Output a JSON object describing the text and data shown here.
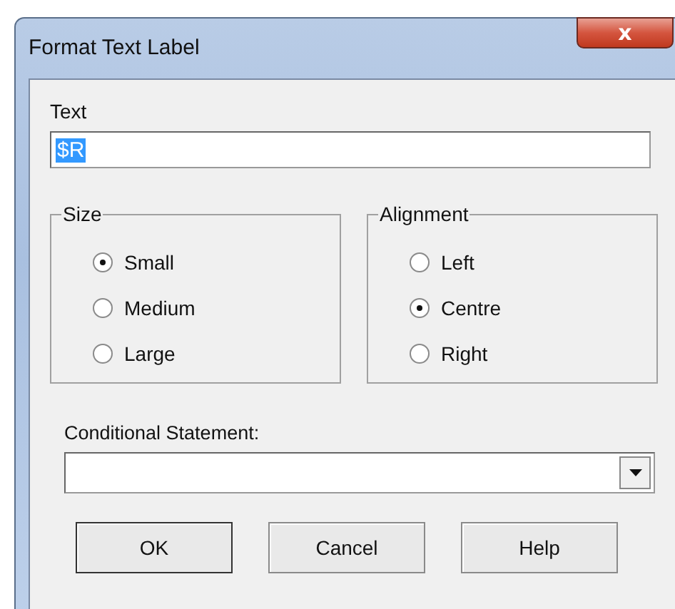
{
  "window": {
    "title": "Format Text Label",
    "close": "x"
  },
  "text_field": {
    "label": "Text",
    "value": "$R",
    "selected": true
  },
  "groups": [
    {
      "title": "Size",
      "options": [
        {
          "label": "Small",
          "selected": true
        },
        {
          "label": "Medium",
          "selected": false
        },
        {
          "label": "Large",
          "selected": false
        }
      ]
    },
    {
      "title": "Alignment",
      "options": [
        {
          "label": "Left",
          "selected": false
        },
        {
          "label": "Centre",
          "selected": true
        },
        {
          "label": "Right",
          "selected": false
        }
      ]
    }
  ],
  "conditional": {
    "label": "Conditional Statement:"
  },
  "buttons": [
    {
      "label": "OK",
      "default": true
    },
    {
      "label": "Cancel",
      "default": false
    },
    {
      "label": "Help",
      "default": false
    }
  ]
}
